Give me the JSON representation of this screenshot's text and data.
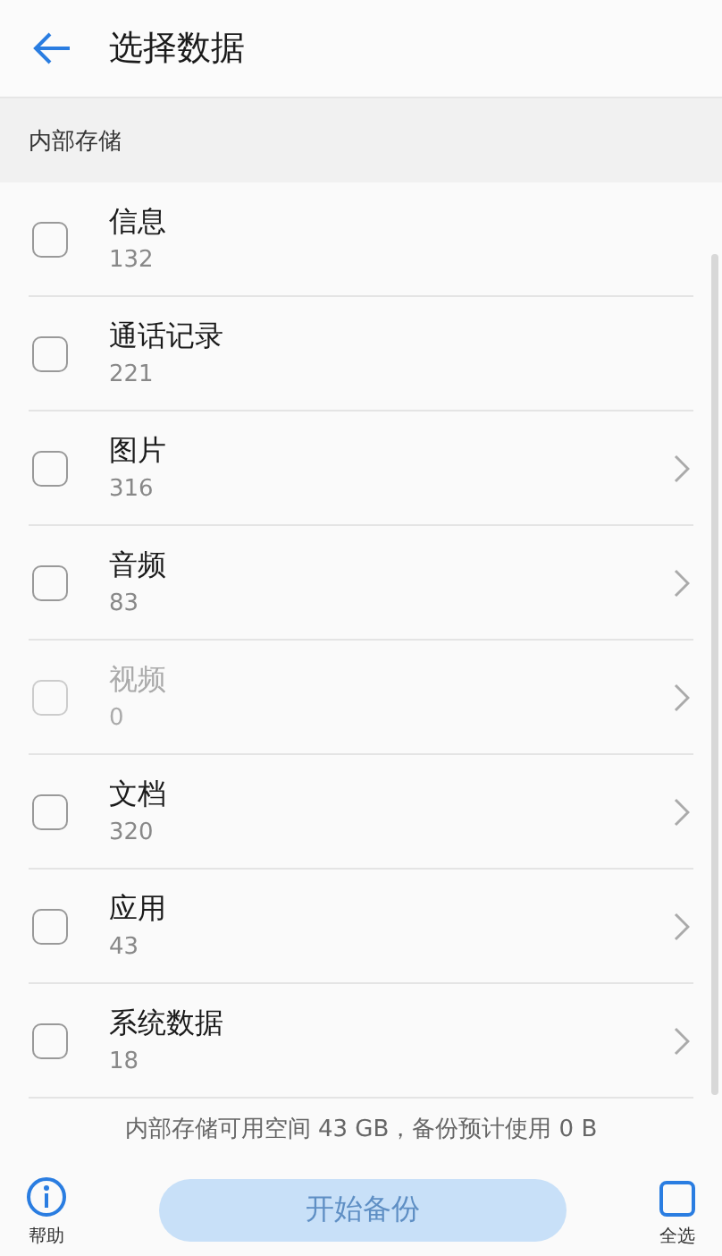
{
  "header": {
    "title": "选择数据"
  },
  "section": {
    "title": "内部存储"
  },
  "items": [
    {
      "name": "信息",
      "count": "132",
      "checked": false,
      "disabled": false,
      "chevron": false
    },
    {
      "name": "通话记录",
      "count": "221",
      "checked": false,
      "disabled": false,
      "chevron": false
    },
    {
      "name": "图片",
      "count": "316",
      "checked": false,
      "disabled": false,
      "chevron": true
    },
    {
      "name": "音频",
      "count": "83",
      "checked": false,
      "disabled": false,
      "chevron": true
    },
    {
      "name": "视频",
      "count": "0",
      "checked": false,
      "disabled": true,
      "chevron": true
    },
    {
      "name": "文档",
      "count": "320",
      "checked": false,
      "disabled": false,
      "chevron": true
    },
    {
      "name": "应用",
      "count": "43",
      "checked": false,
      "disabled": false,
      "chevron": true
    },
    {
      "name": "系统数据",
      "count": "18",
      "checked": false,
      "disabled": false,
      "chevron": true
    }
  ],
  "summary": "内部存储可用空间 43 GB，备份预计使用 0 B",
  "bottom_bar": {
    "help": "帮助",
    "start": {
      "label": "开始备份",
      "disabled": true
    },
    "select_all": "全选"
  }
}
